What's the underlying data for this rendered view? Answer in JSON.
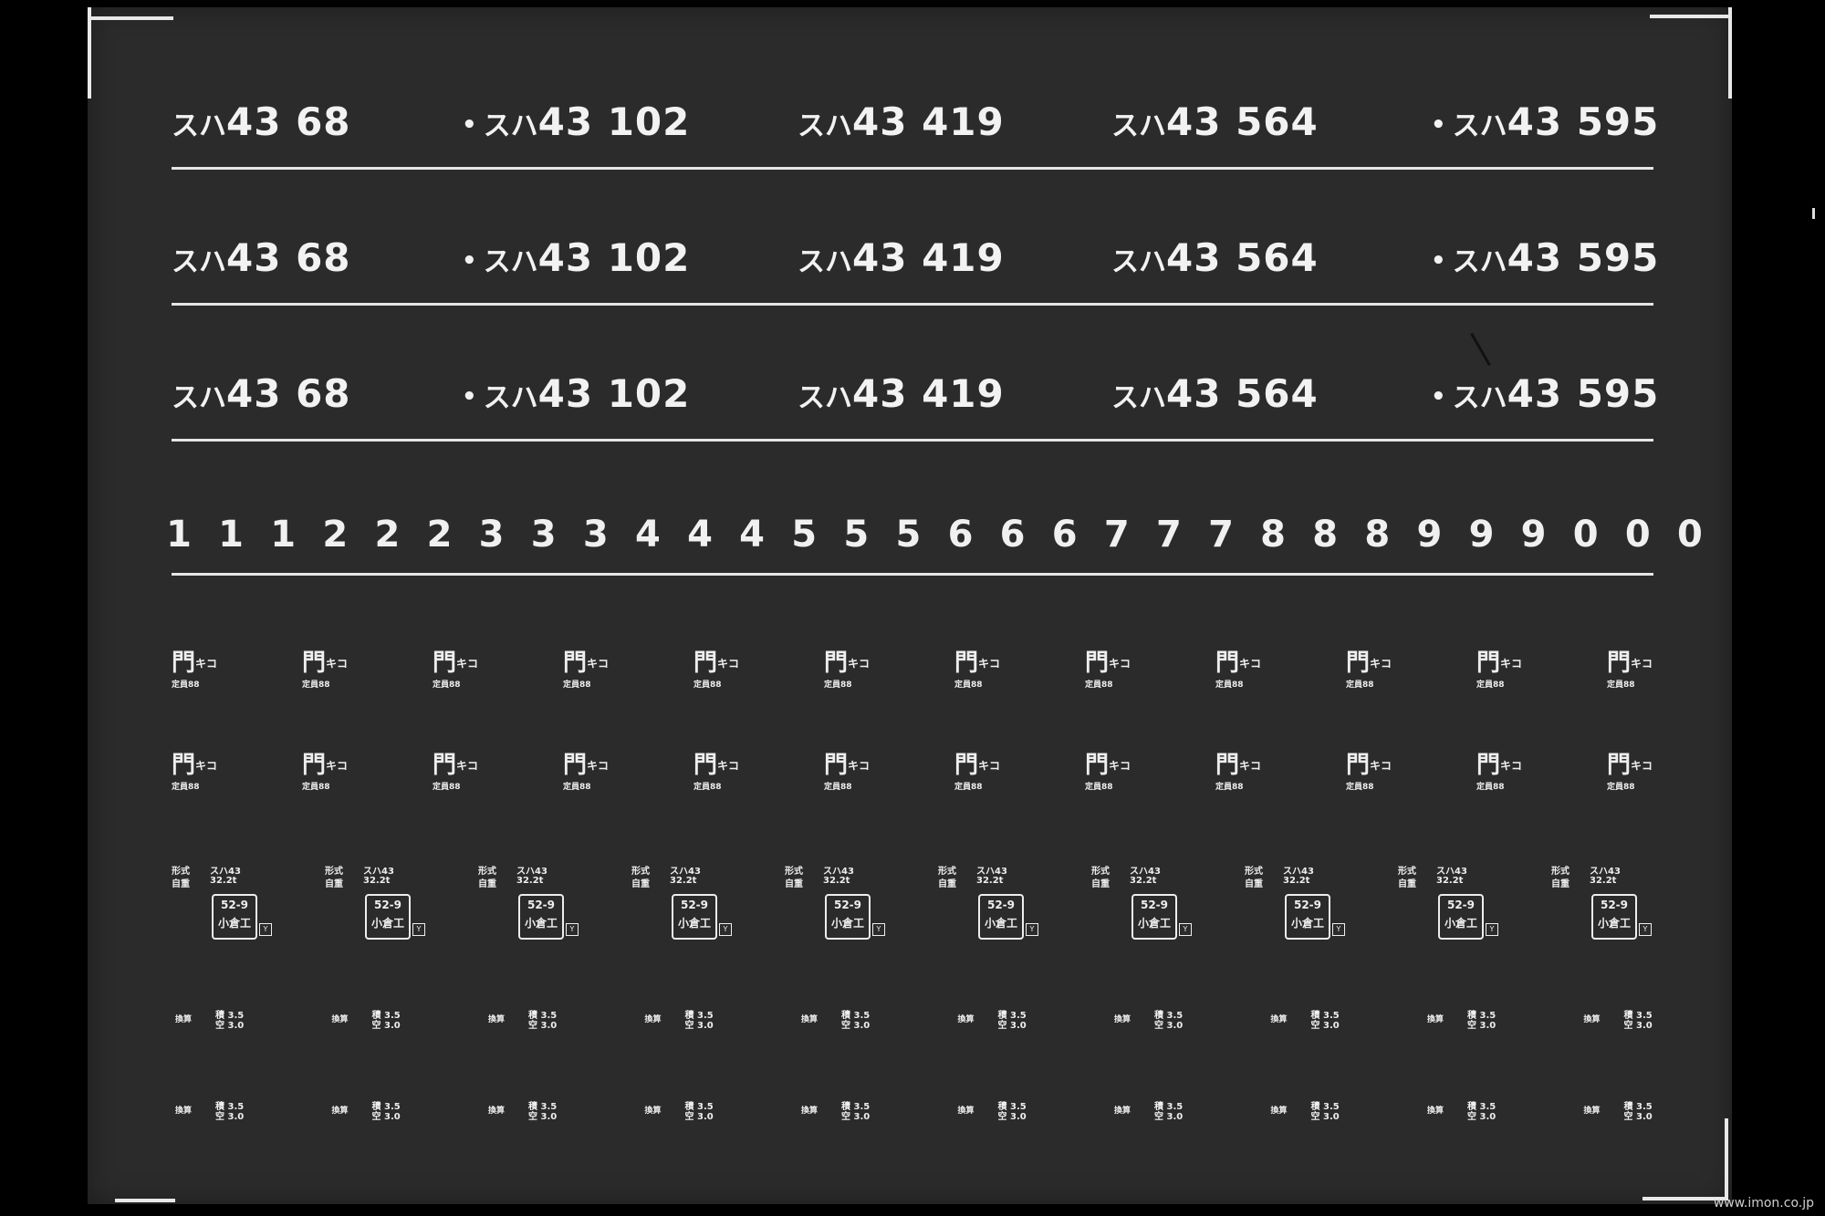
{
  "car_numbers": [
    {
      "kana": "スハ",
      "text": "43 68",
      "dot": false
    },
    {
      "kana": "スハ",
      "text": "43 102",
      "dot": true
    },
    {
      "kana": "スハ",
      "text": "43 419",
      "dot": false
    },
    {
      "kana": "スハ",
      "text": "43 564",
      "dot": false
    },
    {
      "kana": "スハ",
      "text": "43 595",
      "dot": true
    }
  ],
  "digits": [
    "1",
    "1",
    "1",
    "2",
    "2",
    "2",
    "3",
    "3",
    "3",
    "4",
    "4",
    "4",
    "5",
    "5",
    "5",
    "6",
    "6",
    "6",
    "7",
    "7",
    "7",
    "8",
    "8",
    "8",
    "9",
    "9",
    "9",
    "0",
    "0",
    "0"
  ],
  "depot_mark": {
    "big": "門",
    "kana": "キコ",
    "small": "定員88"
  },
  "spec_block": {
    "label1": "形式",
    "label2": "自重",
    "type": "スハ43",
    "weight": "32.2t",
    "box_line1": "52-9",
    "box_line2": "小倉工",
    "badge": "Y"
  },
  "weight_block": {
    "label": "換算",
    "line1": "積 3.5",
    "line2": "空 3.0"
  },
  "credit": "www.imon.co.jp",
  "colors": {
    "sheet": "#2b2b2b",
    "ink": "#f0f0f0",
    "background": "#000000"
  }
}
